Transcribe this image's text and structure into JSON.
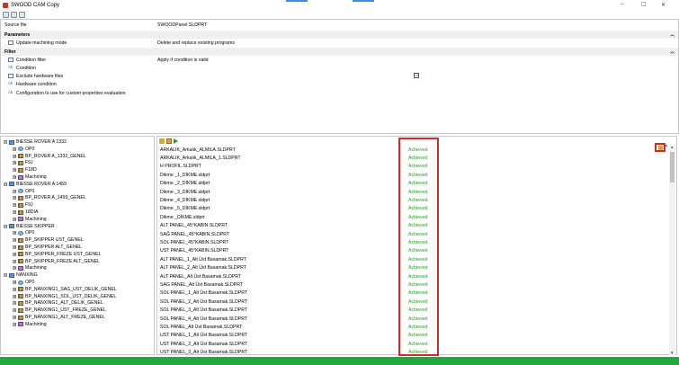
{
  "window": {
    "title": "SWOOD CAM Copy",
    "controls": {
      "minimize": "–",
      "maximize": "☐",
      "close": "✕"
    }
  },
  "properties": {
    "source_file": {
      "label": "Source file",
      "value": "SWOODPanel.SLDPRT"
    },
    "parameters": {
      "header": "Parameters",
      "update_mode": {
        "label": "Update machining mode",
        "value": "Delete and replace existing programs"
      }
    },
    "filter": {
      "header": "Filter",
      "condition_filter": {
        "label": "Condition filter",
        "value": "Apply if condition is valid"
      },
      "condition": {
        "label": "Condition"
      },
      "exclude_hardware": {
        "label": "Exclude hardware files",
        "checked": "☑"
      },
      "hardware_condition": {
        "label": "Hardware condition"
      },
      "config_label": "Configuration to use for custom properties evaluation"
    }
  },
  "tree": [
    {
      "label": "BIESSE ROVER A 1332",
      "type": "machine",
      "expander": "⊟"
    },
    {
      "label": "OP0",
      "type": "op",
      "expander": "⊞"
    },
    {
      "label": "BP_ROVER A_1332_GENEL",
      "type": "prog",
      "expander": "⊞"
    },
    {
      "label": "F9J",
      "type": "prog",
      "expander": "⊞"
    },
    {
      "label": "F18D",
      "type": "prog",
      "expander": "⊞"
    },
    {
      "label": "Machining",
      "type": "mach2",
      "expander": "⊞"
    },
    {
      "label": "BIESSE ROVER A 1459",
      "type": "machine",
      "expander": "⊟"
    },
    {
      "label": "OP0",
      "type": "op",
      "expander": "⊞"
    },
    {
      "label": "BP_ROVER A_1459_GENEL",
      "type": "prog",
      "expander": "⊞"
    },
    {
      "label": "F9J",
      "type": "prog",
      "expander": "⊞"
    },
    {
      "label": "18DIA",
      "type": "prog",
      "expander": "⊞"
    },
    {
      "label": "Machining",
      "type": "mach2",
      "expander": "⊞"
    },
    {
      "label": "BIESSE SKIPPER",
      "type": "machine",
      "expander": "⊟"
    },
    {
      "label": "OP0",
      "type": "op",
      "expander": "⊞"
    },
    {
      "label": "BP_SKIPPER UST_GENEL",
      "type": "prog",
      "expander": "⊞"
    },
    {
      "label": "BP_SKIPPER ALT_GENEL",
      "type": "prog",
      "expander": "⊞"
    },
    {
      "label": "BP_SKIPPER_FREZE UST_GENEL",
      "type": "prog",
      "expander": "⊞"
    },
    {
      "label": "BP_SKIPPER_FREZE ALT_GENEL",
      "type": "prog",
      "expander": "⊞"
    },
    {
      "label": "Machining",
      "type": "mach2",
      "expander": "⊞"
    },
    {
      "label": "NANXING",
      "type": "machine",
      "expander": "⊟"
    },
    {
      "label": "OP0",
      "type": "op",
      "expander": "⊞"
    },
    {
      "label": "BP_NANXING1_SAG_UST_DELIK_GENEL",
      "type": "prog",
      "expander": "⊞"
    },
    {
      "label": "BP_NANXING1_SOL_UST_DELIK_GENEL",
      "type": "prog",
      "expander": "⊞"
    },
    {
      "label": "BP_NANXING1_ALT_DELIK_GENEL",
      "type": "prog",
      "expander": "⊞"
    },
    {
      "label": "BP_NANXING1_UST_FREZE_GENEL",
      "type": "prog",
      "expander": "⊞"
    },
    {
      "label": "BP_NANXING1_ALT_FREZE_GENEL",
      "type": "prog",
      "expander": "⊞"
    },
    {
      "label": "Machining",
      "type": "mach2",
      "expander": "⊞"
    }
  ],
  "files": [
    {
      "name": "ARKALIK_Arkalık_ALMILA.SLDPRT",
      "status": "Achieved"
    },
    {
      "name": "ARKALIK_Arkalık_ALMILA_1.SLDPRT",
      "status": "Achieved"
    },
    {
      "name": "H PROFIL.SLDPRT",
      "status": "Achieved"
    },
    {
      "name": "Dikme _1_DİKME.sldprt",
      "status": "Achieved"
    },
    {
      "name": "Dikme _2_DİKME.sldprt",
      "status": "Achieved"
    },
    {
      "name": "Dikme _3_DİKME.sldprt",
      "status": "Achieved"
    },
    {
      "name": "Dikme _4_DİKME.sldprt",
      "status": "Achieved"
    },
    {
      "name": "Dikme _5_DİKME.sldprt",
      "status": "Achieved"
    },
    {
      "name": "Dikme _DİKME.sldprt",
      "status": "Achieved"
    },
    {
      "name": "ALT PANEL_45°KABIN.SLDPRT",
      "status": "Achieved"
    },
    {
      "name": "SAĞ PANEL_45°KABIN.SLDPRT",
      "status": "Achieved"
    },
    {
      "name": "SOL PANEL_45°KABIN.SLDPRT",
      "status": "Achieved"
    },
    {
      "name": "UST PANEL_45°KABIN.SLDPRT",
      "status": "Achieved"
    },
    {
      "name": "ALT PANEL_1_Alt Üst Basamak.SLDPRT",
      "status": "Achieved"
    },
    {
      "name": "ALT PANEL_2_Alt Üst Basamak.SLDPRT",
      "status": "Achieved"
    },
    {
      "name": "ALT PANEL_Alt Üst Basamak.SLDPRT",
      "status": "Achieved"
    },
    {
      "name": "SAG PANEL_Alt Üst Basamak.SLDPRT",
      "status": "Achieved"
    },
    {
      "name": "SOL PANEL_1_Alt Üst Basamak.SLDPRT",
      "status": "Achieved"
    },
    {
      "name": "SOL PANEL_2_Alt Üst Basamak.SLDPRT",
      "status": "Achieved"
    },
    {
      "name": "SOL PANEL_3_Alt Üst Basamak.SLDPRT",
      "status": "Achieved"
    },
    {
      "name": "SOL PANEL_4_Alt Üst Basamak.SLDPRT",
      "status": "Achieved"
    },
    {
      "name": "SOL PANEL_Alt Üst Basamak.SLDPRT",
      "status": "Achieved"
    },
    {
      "name": "UST PANEL_1_Alt Üst Basamak.SLDPRT",
      "status": "Achieved"
    },
    {
      "name": "UST PANEL_2_Alt Üst Basamak.SLDPRT",
      "status": "Achieved"
    },
    {
      "name": "UST PANEL_3_Alt Üst Basamak.SLDPRT",
      "status": "Achieved"
    }
  ],
  "list_controls": {
    "close": "✕",
    "scroll_up": "▲",
    "scroll_down": "▼"
  },
  "colors": {
    "achieved": "#23a123",
    "highlight": "#d42a2a",
    "status_bar": "#1fa83c"
  }
}
